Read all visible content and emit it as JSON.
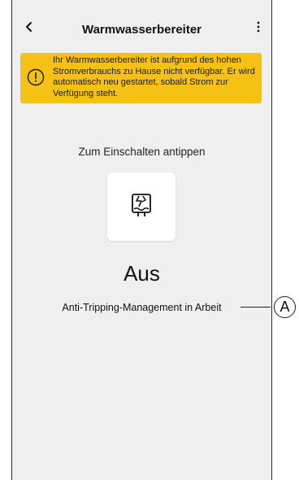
{
  "header": {
    "title": "Warmwasserbereiter",
    "back_icon": "chevron-left-icon",
    "more_icon": "more-vertical-icon"
  },
  "banner": {
    "icon": "warning-circle-icon",
    "text": "Ihr Warmwasserbereiter ist aufgrund des hohen Stromverbrauchs zu Hause nicht verfügbar. Er wird automatisch neu gestartet, sobald Strom zur Verfügung steht.",
    "color": "#f4c114"
  },
  "main": {
    "hint": "Zum Einschalten antippen",
    "device_icon": "water-heater-tripped-icon",
    "state": "Aus",
    "status": "Anti-Tripping-Management in Arbeit"
  },
  "callout": {
    "label": "A"
  }
}
